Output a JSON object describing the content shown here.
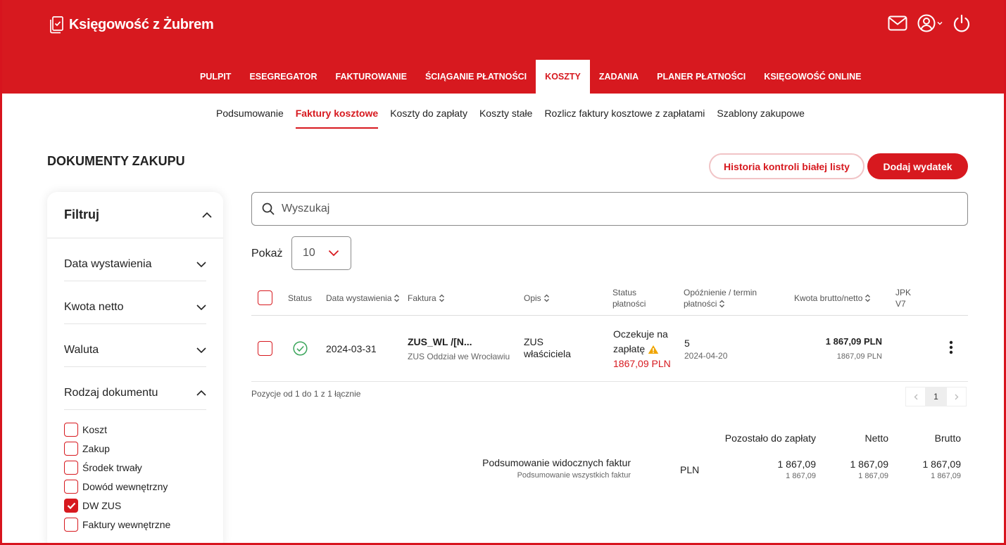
{
  "app": {
    "title": "Księgowość z Żubrem"
  },
  "colors": {
    "brand": "#d7191f",
    "success": "#3aa55a",
    "warning": "#f0a500"
  },
  "header": {
    "icons": [
      "mail-icon",
      "user-icon",
      "power-icon"
    ]
  },
  "main_nav": [
    {
      "label": "PULPIT"
    },
    {
      "label": "ESEGREGATOR"
    },
    {
      "label": "FAKTUROWANIE"
    },
    {
      "label": "ŚCIĄGANIE PŁATNOŚCI"
    },
    {
      "label": "KOSZTY",
      "active": true
    },
    {
      "label": "ZADANIA"
    },
    {
      "label": "PLANER PŁATNOŚCI"
    },
    {
      "label": "KSIĘGOWOŚĆ ONLINE"
    }
  ],
  "sub_nav": [
    {
      "label": "Podsumowanie"
    },
    {
      "label": "Faktury kosztowe",
      "active": true
    },
    {
      "label": "Koszty do zapłaty"
    },
    {
      "label": "Koszty stałe"
    },
    {
      "label": "Rozlicz faktury kosztowe z zapłatami"
    },
    {
      "label": "Szablony zakupowe"
    }
  ],
  "page": {
    "title": "DOKUMENTY ZAKUPU",
    "btn_history": "Historia kontroli białej listy",
    "btn_add": "Dodaj wydatek"
  },
  "filter": {
    "title": "Filtruj",
    "sections": [
      "Data wystawienia",
      "Kwota netto",
      "Waluta",
      "Rodzaj dokumentu"
    ],
    "doc_types": [
      {
        "label": "Koszt",
        "checked": false
      },
      {
        "label": "Zakup",
        "checked": false
      },
      {
        "label": "Środek trwały",
        "checked": false
      },
      {
        "label": "Dowód wewnętrzny",
        "checked": false
      },
      {
        "label": "DW ZUS",
        "checked": true
      },
      {
        "label": "Faktury wewnętrzne",
        "checked": false
      }
    ]
  },
  "search": {
    "placeholder": "Wyszukaj"
  },
  "pokaz": {
    "label": "Pokaż",
    "value": "10"
  },
  "table": {
    "headers": {
      "status": "Status",
      "date": "Data wystawienia",
      "invoice": "Faktura",
      "desc": "Opis",
      "pay_status_1": "Status",
      "pay_status_2": "płatności",
      "delay_1": "Opóźnienie / termin",
      "delay_2": "płatności",
      "amount": "Kwota brutto/netto",
      "jpk_1": "JPK",
      "jpk_2": "V7"
    },
    "rows": [
      {
        "date": "2024-03-31",
        "invoice": "ZUS_WL /[N...",
        "invoice_sub": "ZUS Oddział we Wrocławiu",
        "desc_1": "ZUS",
        "desc_2": "właściciela",
        "pay_status_1": "Oczekuje na",
        "pay_status_2": "zapłatę",
        "pay_amount": "1867,09 PLN",
        "delay": "5",
        "due": "2024-04-20",
        "gross": "1 867,09 PLN",
        "net": "1867,09 PLN"
      }
    ]
  },
  "pagination": {
    "info": "Pozycje od 1 do 1 z 1 łącznie",
    "current": "1"
  },
  "summary": {
    "col_remaining": "Pozostało do zapłaty",
    "col_net": "Netto",
    "col_gross": "Brutto",
    "visible_label": "Podsumowanie widocznych faktur",
    "all_label": "Podsumowanie wszystkich faktur",
    "currency": "PLN",
    "visible_remaining": "1 867,09",
    "visible_net": "1 867,09",
    "visible_gross": "1 867,09",
    "all_remaining": "1 867,09",
    "all_net": "1 867,09",
    "all_gross": "1 867,09"
  }
}
